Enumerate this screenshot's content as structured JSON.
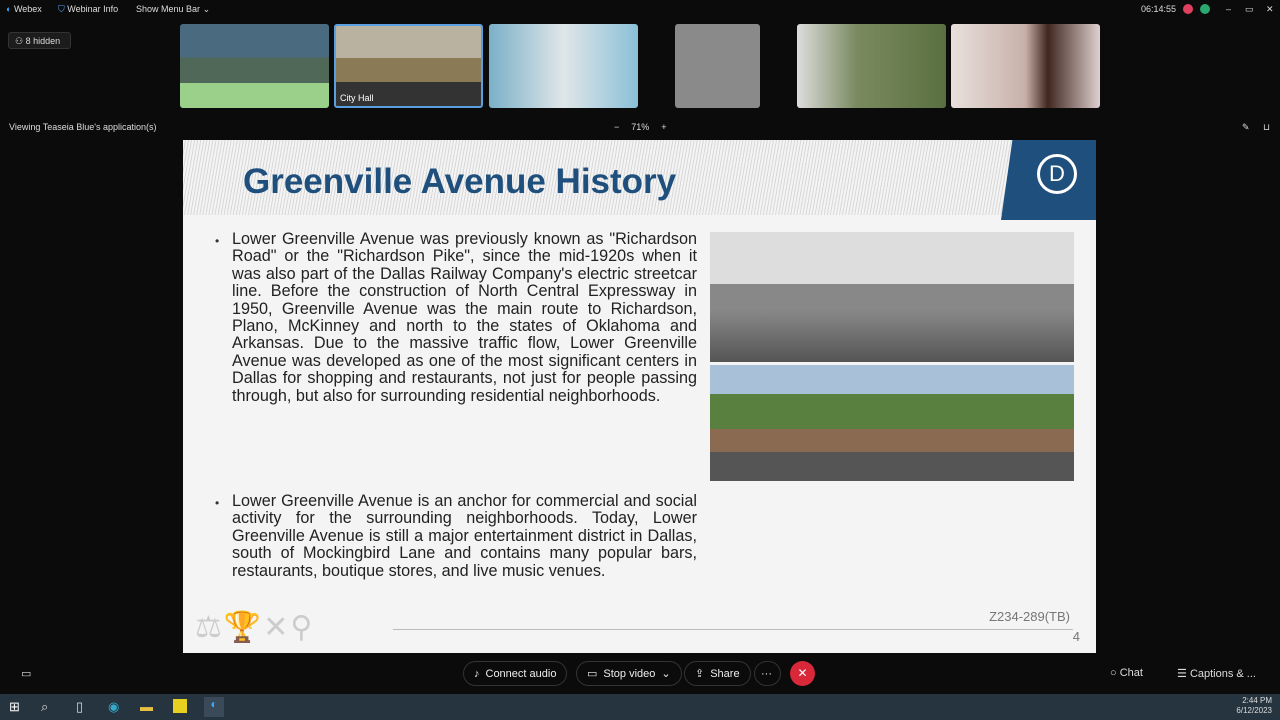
{
  "topbar": {
    "app": "Webex",
    "webinar_info": "Webinar Info",
    "show_menu": "Show Menu Bar",
    "timer": "06:14:55"
  },
  "hidden": "8 hidden",
  "viewing": "Viewing Teaseia Blue's application(s)",
  "zoom": {
    "minus": "−",
    "level": "71%",
    "plus": "+"
  },
  "thumbs": [
    {
      "label": ""
    },
    {
      "label": "City Hall"
    },
    {
      "label": ""
    },
    {
      "label": ""
    },
    {
      "label": ""
    },
    {
      "label": ""
    }
  ],
  "slide": {
    "title": "Greenville Avenue History",
    "bullets": [
      "Lower Greenville Avenue was previously known as \"Richardson Road\" or the \"Richardson Pike\", since the mid-1920s when it was also part of the Dallas Railway Company's electric streetcar line. Before the construction of North Central Expressway in 1950, Greenville Avenue was the main route to Richardson, Plano, McKinney and north to the states of Oklahoma and Arkansas. Due to the massive traffic flow, Lower Greenville Avenue was developed as one of the most significant centers in Dallas for shopping and restaurants, not just for people passing through, but also for surrounding residential neighborhoods.",
      "Lower Greenville Avenue is an anchor for commercial and social activity for the surrounding neighborhoods. Today, Lower Greenville Avenue is still a major entertainment district in Dallas, south of Mockingbird Lane and contains many popular bars, restaurants, boutique stores, and live music venues."
    ],
    "case": "Z234-289(TB)",
    "page": "4"
  },
  "controls": {
    "audio": "Connect audio",
    "video": "Stop video",
    "share": "Share",
    "more": "···",
    "chat": "Chat",
    "captions": "Captions & ..."
  },
  "taskbar": {
    "time": "2:44 PM",
    "date": "6/12/2023"
  }
}
